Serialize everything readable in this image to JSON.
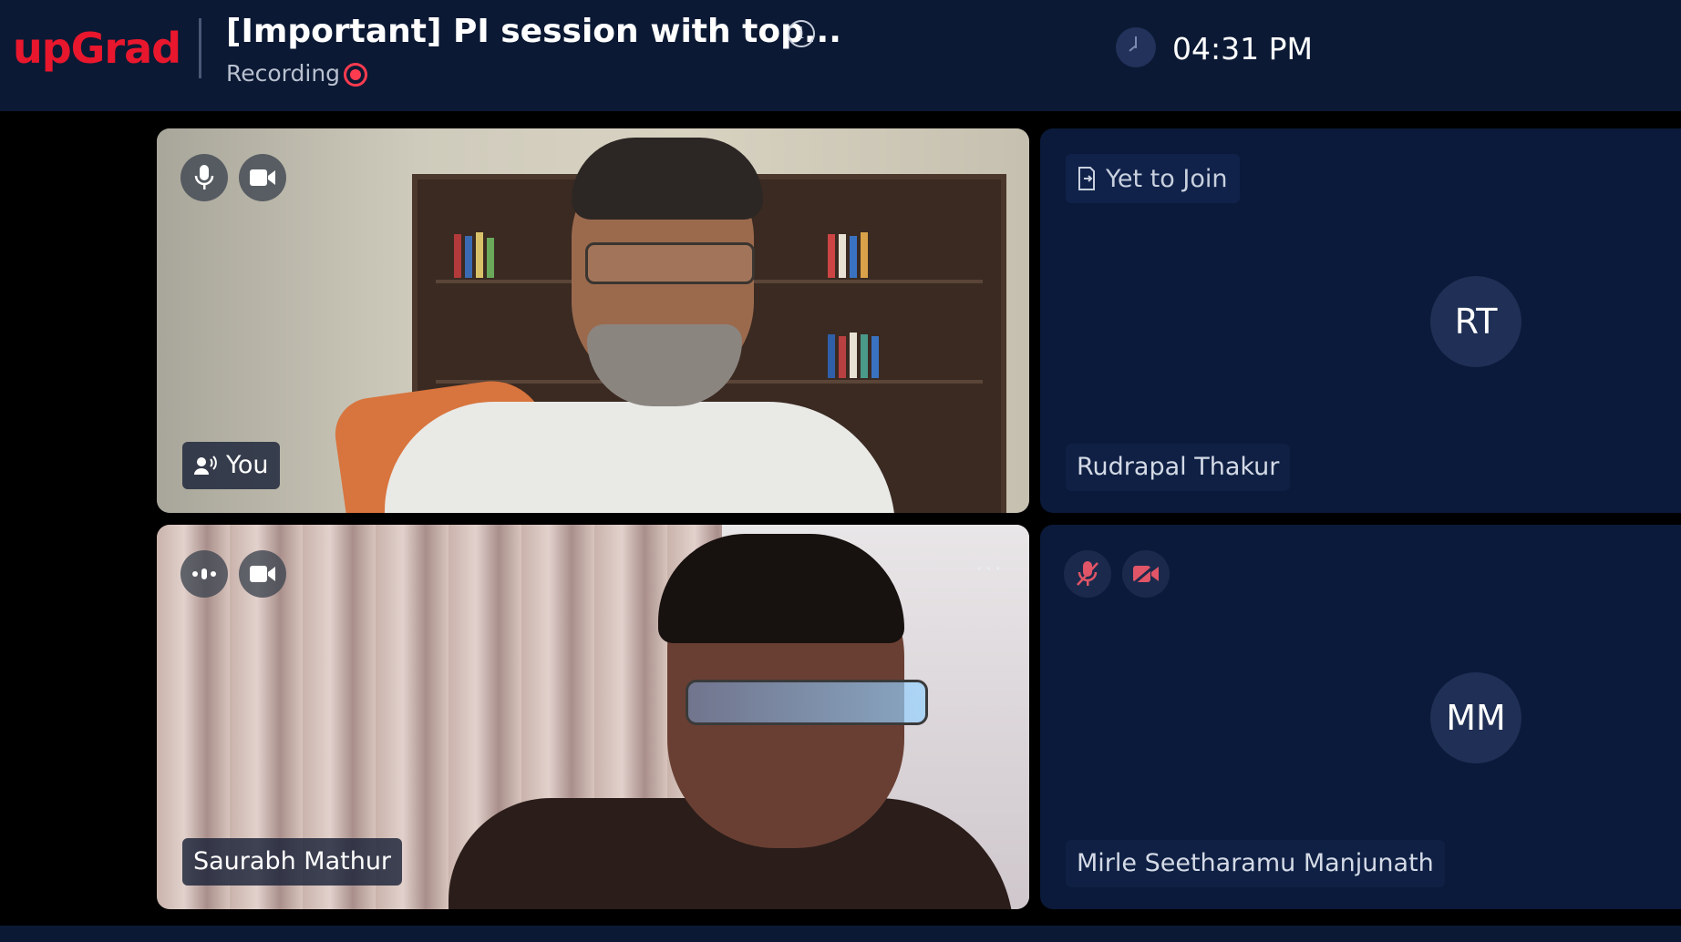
{
  "header": {
    "logo": "upGrad",
    "title": "[Important] PI session with top...",
    "info_icon": "info-icon",
    "recording_label": "Recording",
    "clock_time": "04:31 PM"
  },
  "participants": [
    {
      "name": "You",
      "state": "video",
      "controls": [
        "microphone-icon",
        "video-camera-icon"
      ],
      "speaking_indicator": "speaker-icon"
    },
    {
      "name": "Rudrapal Thakur",
      "initials": "RT",
      "status_label": "Yet to Join",
      "state": "not-joined"
    },
    {
      "name": "Saurabh Mathur",
      "state": "video",
      "controls": [
        "audio-activity-icon",
        "video-camera-icon"
      ],
      "more_label": "···"
    },
    {
      "name": "Mirle Seetharamu Manjunath",
      "initials": "MM",
      "state": "muted",
      "controls": [
        "microphone-muted-icon",
        "video-camera-off-icon"
      ]
    }
  ],
  "colors": {
    "brand": "#e8172d",
    "header_bg": "#0b1934",
    "tile_empty_bg": "#0b1a3a",
    "recording": "#ff3b4f",
    "muted_icon": "#e05567"
  }
}
